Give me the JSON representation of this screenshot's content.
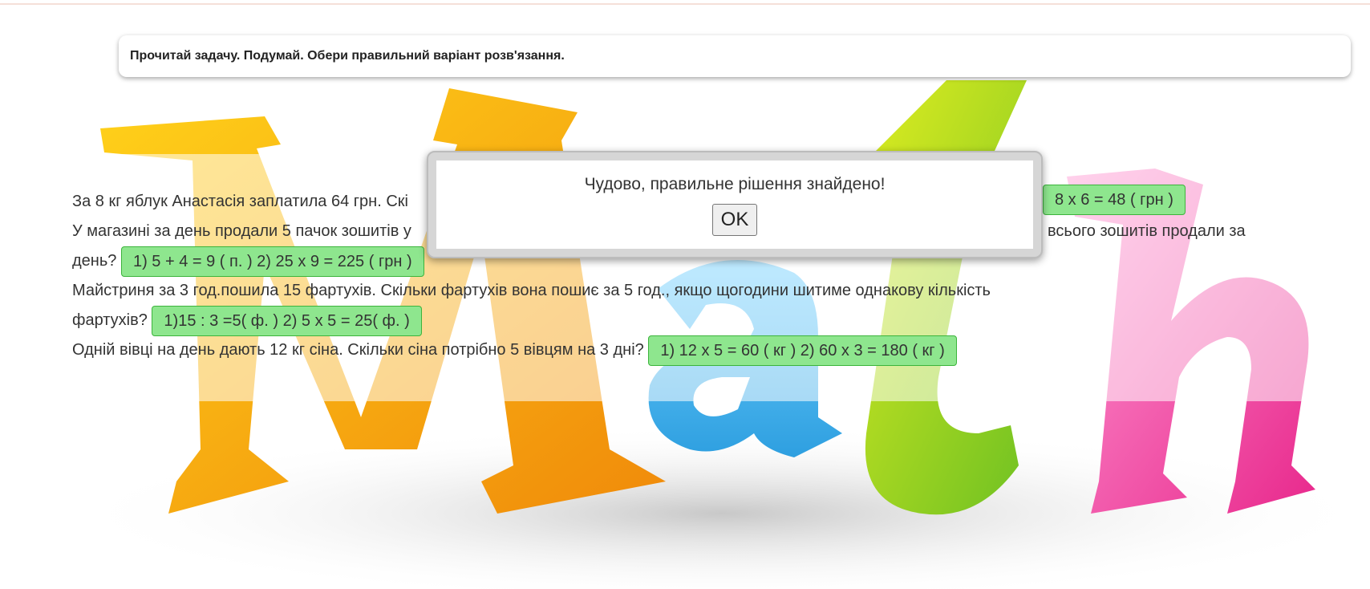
{
  "instruction": "Прочитай задачу. Подумай. Обери правильний варіант розв'язання.",
  "tasks": [
    {
      "question": "За 8 кг яблук Анастасія заплатила 64 грн. Скі",
      "answer": "8 x 6 = 48 ( грн )"
    },
    {
      "question_line1": "У магазині за день продали 5 пачок зошитів у",
      "question_line1_end": "всього зошитів продали за",
      "question_line2": "день?",
      "answer": "1) 5 + 4 = 9 ( п. ) 2) 25 x 9 = 225 ( грн )"
    },
    {
      "question_line1": "Майстриня за 3 год.пошила 15 фартухів. Скільки фартухів вона пошиє за 5 год., якщо щогодини шитиме однакову кількість",
      "question_line2": "фартухів?",
      "answer": "1)15 : 3 =5( ф. ) 2) 5 x 5 = 25( ф. )"
    },
    {
      "question": "Одній вівці на день дають 12 кг сіна. Скільки сіна потрібно 5 вівцям на 3 дні?",
      "answer": "1) 12 x 5 = 60 ( кг ) 2) 60 x 3 = 180 ( кг )"
    }
  ],
  "dialog": {
    "message": "Чудово, правильне рішення знайдено!",
    "ok_label": "OK"
  },
  "background": {
    "logo_text": "Math",
    "colors": {
      "M": "#f7a21b",
      "a": "#f59a12",
      "t_blue": "#4fb8f0",
      "t_green": "#8fd12a",
      "h": "#f048a8"
    }
  }
}
